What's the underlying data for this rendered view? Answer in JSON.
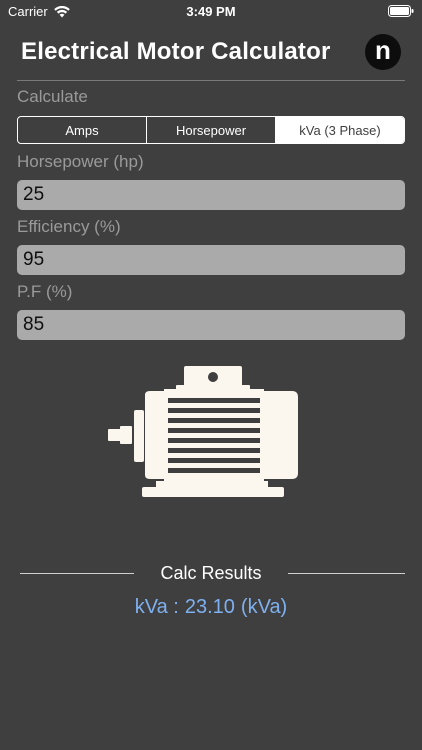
{
  "status_bar": {
    "carrier": "Carrier",
    "time": "3:49 PM"
  },
  "header": {
    "title": "Electrical Motor Calculator",
    "logo_letter": "n"
  },
  "calculate": {
    "label": "Calculate",
    "options": [
      "Amps",
      "Horsepower",
      "kVa (3 Phase)"
    ],
    "selected": "kVa (3 Phase)"
  },
  "fields": {
    "horsepower": {
      "label": "Horsepower (hp)",
      "value": "25"
    },
    "efficiency": {
      "label": "Efficiency (%)",
      "value": "95"
    },
    "power_factor": {
      "label": "P.F (%)",
      "value": "85"
    }
  },
  "results": {
    "heading": "Calc Results",
    "name": "kVa :",
    "value": "23.10",
    "unit": "(kVa)"
  },
  "colors": {
    "background": "#3f3f3f",
    "field_fill": "#aaaaaa",
    "result_text": "#7fb0f0",
    "motor_fill": "#fbf7ee"
  },
  "icons": [
    "wifi-icon",
    "battery-icon",
    "electric-motor-icon"
  ]
}
